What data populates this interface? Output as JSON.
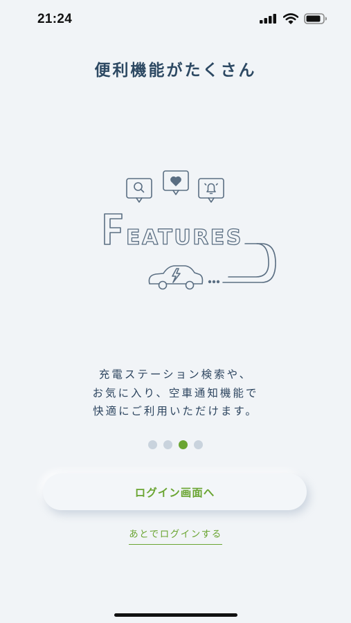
{
  "status_bar": {
    "time": "21:24",
    "icons": [
      "cellular-signal-icon",
      "wifi-icon",
      "battery-icon"
    ]
  },
  "page": {
    "title": "便利機能がたくさん"
  },
  "illustration": {
    "word": "FEATURES",
    "icons": [
      "search-bubble-icon",
      "heart-bubble-icon",
      "bell-bubble-icon",
      "ev-car-icon"
    ]
  },
  "description": {
    "lines": [
      "充電ステーション検索や、",
      "お気に入り、空車通知機能で",
      "快適にご利用いただけます。"
    ]
  },
  "pager": {
    "total": 4,
    "current_index": 2
  },
  "actions": {
    "login_label": "ログイン画面へ",
    "later_label": "あとでログインする"
  },
  "colors": {
    "background": "#f1f4f7",
    "accent_green": "#6aa532",
    "title_navy": "#2d4963",
    "dot_inactive": "#c9d3dd",
    "illustration_stroke": "#5a6e82"
  }
}
